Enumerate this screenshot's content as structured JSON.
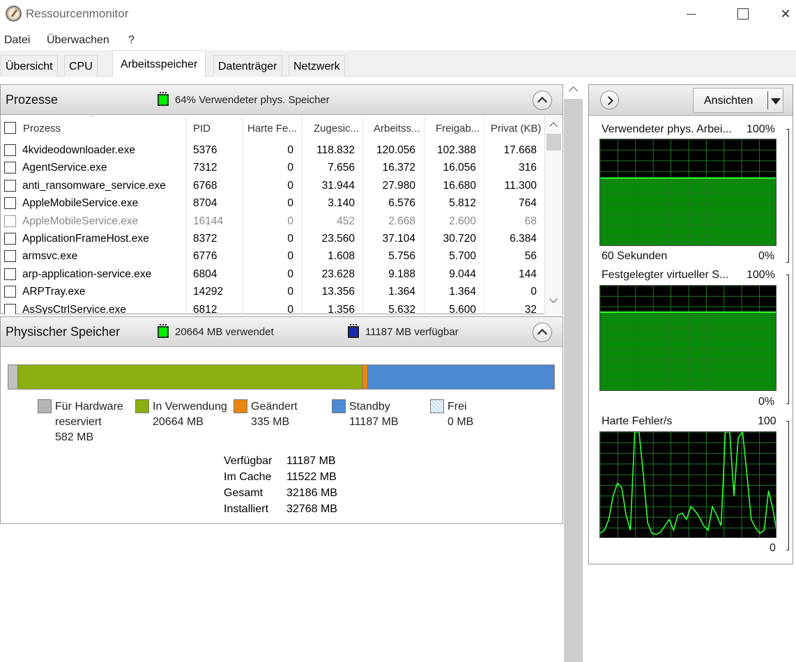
{
  "window": {
    "title": "Ressourcenmonitor"
  },
  "menu": [
    "Datei",
    "Überwachen",
    "?"
  ],
  "tabs": [
    "Übersicht",
    "CPU",
    "Arbeitsspeicher",
    "Datenträger",
    "Netzwerk"
  ],
  "processes": {
    "title": "Prozesse",
    "header_info": "64% Verwendeter phys. Speicher",
    "columns": [
      "Prozess",
      "PID",
      "Harte Fe...",
      "Zugesic...",
      "Arbeitss...",
      "Freigab...",
      "Privat (KB)"
    ],
    "rows": [
      {
        "name": "4kvideodownloader.exe",
        "pid": "5376",
        "hard": "0",
        "commit": "118.832",
        "working": "120.056",
        "shareable": "102.388",
        "private": "17.668",
        "dim": false
      },
      {
        "name": "AgentService.exe",
        "pid": "7312",
        "hard": "0",
        "commit": "7.656",
        "working": "16.372",
        "shareable": "16.056",
        "private": "316",
        "dim": false
      },
      {
        "name": "anti_ransomware_service.exe",
        "pid": "6768",
        "hard": "0",
        "commit": "31.944",
        "working": "27.980",
        "shareable": "16.680",
        "private": "11.300",
        "dim": false
      },
      {
        "name": "AppleMobileService.exe",
        "pid": "8704",
        "hard": "0",
        "commit": "3.140",
        "working": "6.576",
        "shareable": "5.812",
        "private": "764",
        "dim": false
      },
      {
        "name": "AppleMobileService.exe",
        "pid": "16144",
        "hard": "0",
        "commit": "452",
        "working": "2.668",
        "shareable": "2.600",
        "private": "68",
        "dim": true
      },
      {
        "name": "ApplicationFrameHost.exe",
        "pid": "8372",
        "hard": "0",
        "commit": "23.560",
        "working": "37.104",
        "shareable": "30.720",
        "private": "6.384",
        "dim": false
      },
      {
        "name": "armsvc.exe",
        "pid": "6776",
        "hard": "0",
        "commit": "1.608",
        "working": "5.756",
        "shareable": "5.700",
        "private": "56",
        "dim": false
      },
      {
        "name": "arp-application-service.exe",
        "pid": "6804",
        "hard": "0",
        "commit": "23.628",
        "working": "9.188",
        "shareable": "9.044",
        "private": "144",
        "dim": false
      },
      {
        "name": "ARPTray.exe",
        "pid": "14292",
        "hard": "0",
        "commit": "13.356",
        "working": "1.364",
        "shareable": "1.364",
        "private": "0",
        "dim": false
      },
      {
        "name": "AsSysCtrlService.exe",
        "pid": "6812",
        "hard": "0",
        "commit": "1.356",
        "working": "5.632",
        "shareable": "5.600",
        "private": "32",
        "dim": false
      }
    ]
  },
  "physical": {
    "title": "Physischer Speicher",
    "used_text": "20664 MB verwendet",
    "available_text": "11187 MB verfügbar",
    "bar": [
      {
        "name": "Für Hardware reserviert",
        "mb": 582,
        "color": "#c0c0c0"
      },
      {
        "name": "In Verwendung",
        "mb": 20664,
        "color": "#8caf10"
      },
      {
        "name": "Geändert",
        "mb": 335,
        "color": "#e9860f"
      },
      {
        "name": "Standby",
        "mb": 11187,
        "color": "#4b8ad3"
      },
      {
        "name": "Frei",
        "mb": 0,
        "color": "#d9e9f7"
      }
    ],
    "legend": [
      {
        "line1": "Für Hardware",
        "line2": "reserviert",
        "value": "582 MB",
        "color": "#b5b5b5"
      },
      {
        "line1": "In Verwendung",
        "value": "20664 MB",
        "color": "#8caf10"
      },
      {
        "line1": "Geändert",
        "value": "335 MB",
        "color": "#e9860f"
      },
      {
        "line1": "Standby",
        "value": "11187 MB",
        "color": "#4b8ad3"
      },
      {
        "line1": "Frei",
        "value": "0 MB",
        "color": "#c5dcf2"
      }
    ],
    "stats": [
      {
        "label": "Verfügbar",
        "value": "11187 MB"
      },
      {
        "label": "Im Cache",
        "value": "11522 MB"
      },
      {
        "label": "Gesamt",
        "value": "32186 MB"
      },
      {
        "label": "Installiert",
        "value": "32768 MB"
      }
    ]
  },
  "graphs": {
    "views_label": "Ansichten",
    "g1": {
      "title": "Verwendeter phys. Arbei...",
      "max": "100%",
      "time": "60 Sekunden",
      "min": "0%",
      "level_percent": 64
    },
    "g2": {
      "title": "Festgelegter virtueller S...",
      "max": "100%",
      "min": "0%",
      "level_percent": 75
    },
    "g3": {
      "title": "Harte Fehler/s",
      "max": "100",
      "min": "0",
      "values": [
        5,
        8,
        18,
        40,
        52,
        48,
        22,
        8,
        100,
        100,
        60,
        15,
        5,
        4,
        6,
        12,
        18,
        8,
        22,
        24,
        18,
        30,
        26,
        20,
        12,
        8,
        30,
        22,
        12,
        100,
        100,
        40,
        95,
        100,
        60,
        18,
        10,
        5,
        8,
        45,
        28,
        4
      ]
    }
  }
}
